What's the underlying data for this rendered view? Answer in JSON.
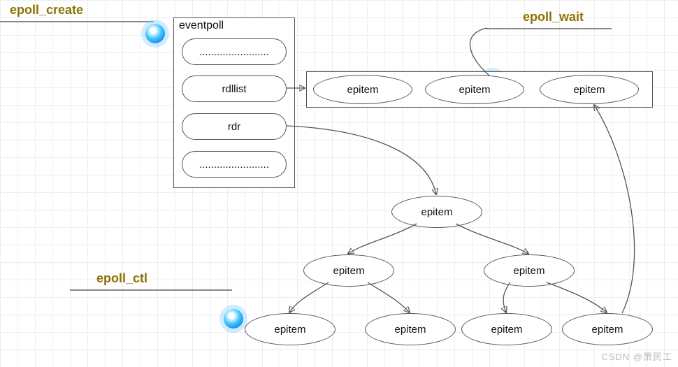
{
  "labels": {
    "create": "epoll_create",
    "wait": "epoll_wait",
    "ctl": "epoll_ctl"
  },
  "eventpoll": {
    "title": "eventpoll",
    "rows": [
      "........................",
      "rdllist",
      "rdr",
      "........................"
    ]
  },
  "rdllist_items": [
    "epitem",
    "epitem",
    "epitem"
  ],
  "tree": {
    "root": "epitem",
    "left": "epitem",
    "right": "epitem",
    "ll": "epitem",
    "lr": "epitem",
    "rl": "epitem",
    "rr": "epitem"
  },
  "watermark": "CSDN @萧民工"
}
